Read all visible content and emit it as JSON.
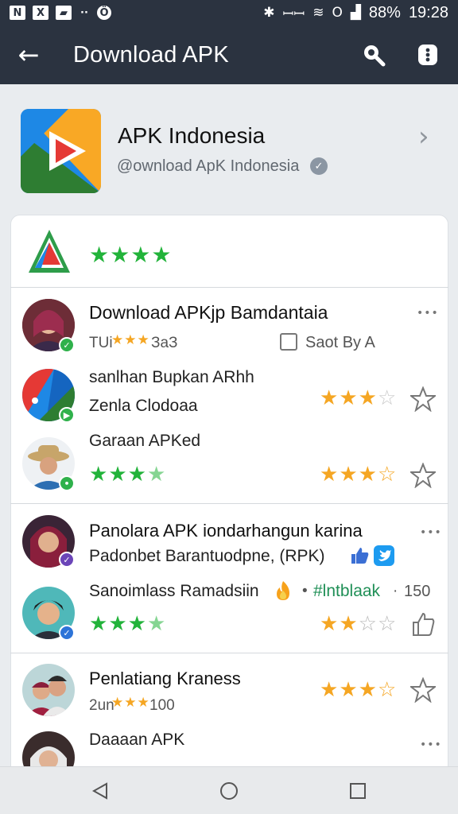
{
  "status_bar": {
    "left_icons": [
      "N",
      "X",
      "▰",
      "··",
      "Ö"
    ],
    "right_glyphs": [
      "✱",
      "ꟷꟷ",
      "≋",
      "O",
      "▟"
    ],
    "battery": "88%",
    "time": "19:28"
  },
  "app_bar": {
    "title": "Download APK",
    "back_icon": "←"
  },
  "profile": {
    "name": "APK Indonesia",
    "handle": "@ownload ApK Indonesia",
    "chevron": "›",
    "logo_colors": [
      "#e53935",
      "#f9a825",
      "#2e7d32",
      "#1e88e5"
    ]
  },
  "summary": {
    "rating": 4
  },
  "posts": [
    {
      "title": "Download APKjp Bamdantaia",
      "meta_prefix": "TUi",
      "meta_suffix": "ЗаЗ",
      "meta_rating": 3,
      "sort_label": "Saot By A",
      "dots": "•••"
    },
    {
      "line1": "sanlhan Bupkan ARhh",
      "line2": "Zenla Clodoaa",
      "rating": 3,
      "fav_icon": "star-outline"
    },
    {
      "line1": "Garaan APKed",
      "rating": 3.5,
      "own_rating": 3
    },
    {
      "title": "Panolara APK  iondarhangun karina",
      "subtitle": "Padonbet Barantuodpne, (RPK)",
      "dots": "•••"
    },
    {
      "line1": "Sanoimlass Ramadsiin",
      "hashtag": "#lntblaak",
      "count": "150",
      "rating": 3.5,
      "own_rating": 2
    },
    {
      "title": "Penlatiang Kraness",
      "meta_prefix": "2un",
      "meta_suffix": "100",
      "meta_rating": 3,
      "own_rating": 3
    },
    {
      "line1": "Daaaan APK",
      "dots": "•••"
    }
  ],
  "nav": {
    "back": "◁",
    "home": "○",
    "recent": "□"
  },
  "colors": {
    "bar_bg": "#2b3340",
    "star_green": "#22b33a",
    "star_orange": "#f5a623",
    "accent_teal": "#1f8f56"
  }
}
